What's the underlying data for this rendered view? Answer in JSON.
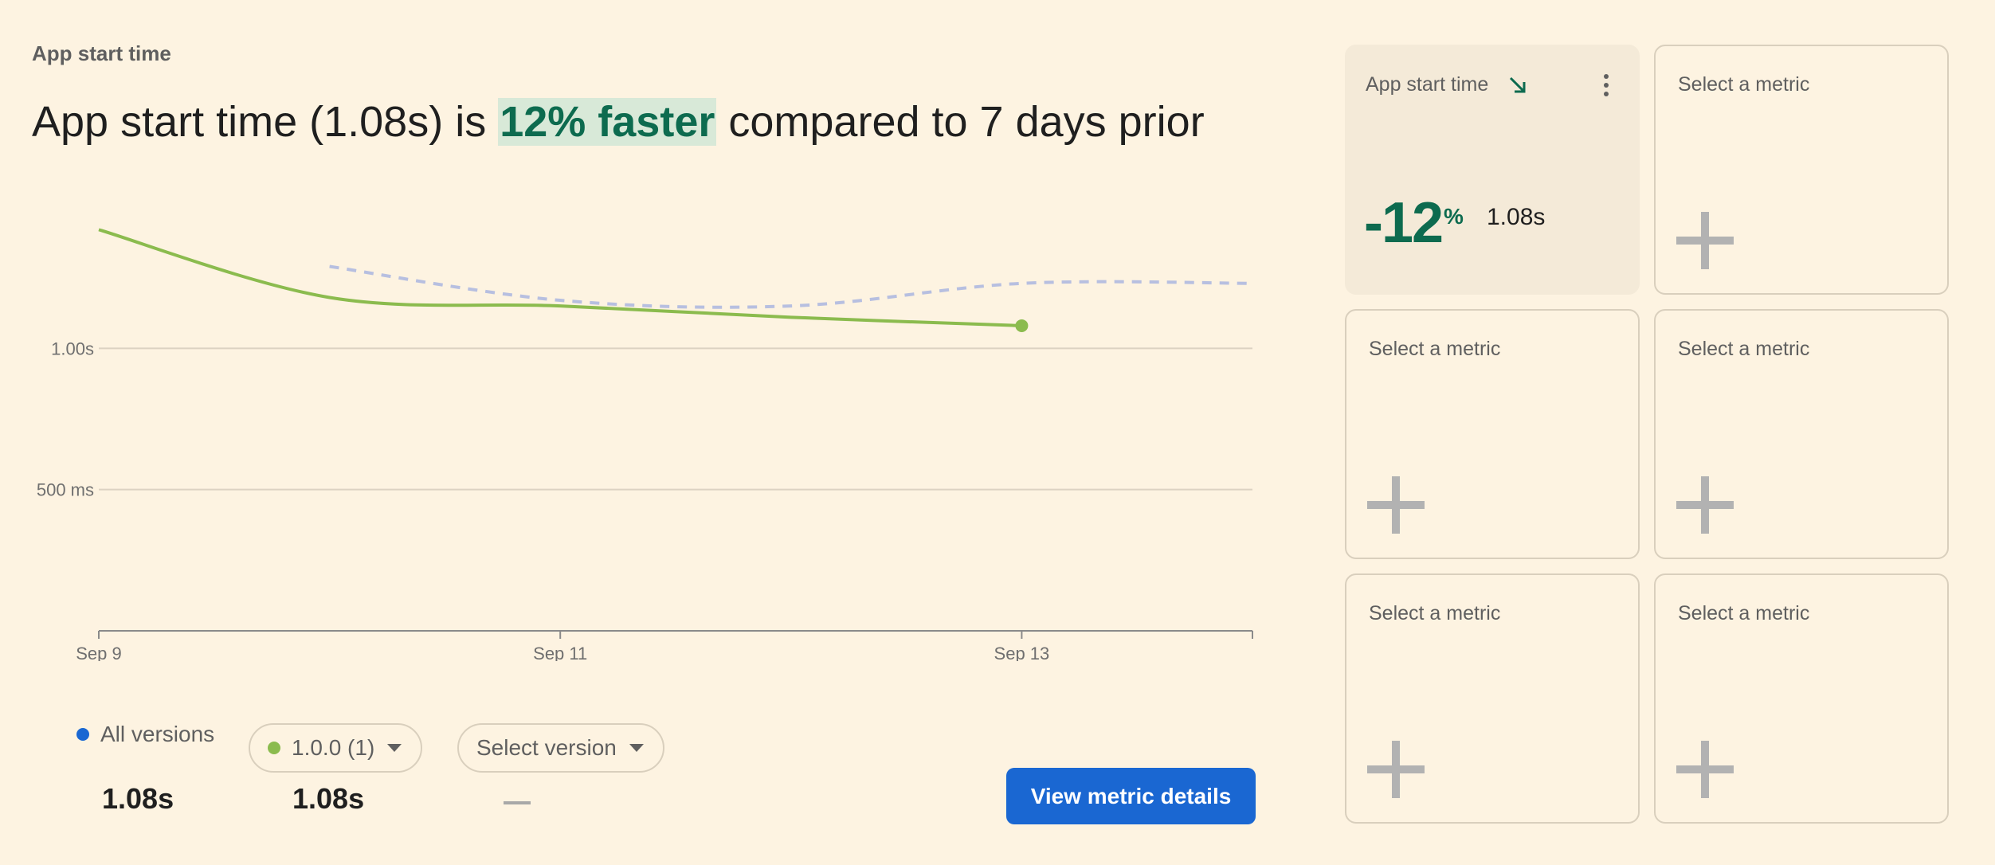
{
  "section_label": "App start time",
  "headline": {
    "prefix": "App start time (1.08s) is ",
    "highlight": "12% faster",
    "suffix": " compared to 7 days prior"
  },
  "colors": {
    "current_series": "#8bbb4e",
    "previous_series": "#b7bfe0",
    "all_versions_dot": "#1a67d2",
    "positive_green": "#0d6b4f",
    "button_blue": "#1a67d2",
    "background": "#fdf3e1"
  },
  "chart_data": {
    "type": "line",
    "x_axis": {
      "ticks": [
        "Sep 9",
        "Sep 11",
        "Sep 13"
      ]
    },
    "y_axis": {
      "ticks": [
        "1.00s",
        "500 ms"
      ],
      "tick_values_ms": [
        1000,
        500
      ],
      "range_ms": [
        0,
        1500
      ]
    },
    "grid": true,
    "series": [
      {
        "name": "1.0.0 (1)",
        "style": "solid",
        "x_days": [
          9,
          10,
          11,
          12,
          13
        ],
        "values_ms": [
          1420,
          1180,
          1150,
          1110,
          1080
        ]
      },
      {
        "style": "dashed",
        "x_days": [
          10,
          11,
          12,
          13,
          14,
          15
        ],
        "values_ms": [
          1290,
          1170,
          1150,
          1230,
          1230,
          1210
        ]
      }
    ]
  },
  "legend": {
    "all_versions": {
      "label": "All versions",
      "value": "1.08s"
    },
    "version_chip": {
      "label": "1.0.0 (1)",
      "value": "1.08s"
    },
    "select_version": {
      "label": "Select version",
      "value": "—"
    }
  },
  "view_button": "View metric details",
  "metric_cards": [
    {
      "title": "App start time",
      "trend_icon": "trending-down-icon",
      "menu_icon": "more-vert-icon",
      "change": "-12",
      "change_unit": "%",
      "value": "1.08s"
    },
    {
      "title": "Select a metric",
      "icon": "plus-icon"
    },
    {
      "title": "Select a metric",
      "icon": "plus-icon"
    },
    {
      "title": "Select a metric",
      "icon": "plus-icon"
    },
    {
      "title": "Select a metric",
      "icon": "plus-icon"
    },
    {
      "title": "Select a metric",
      "icon": "plus-icon"
    }
  ]
}
